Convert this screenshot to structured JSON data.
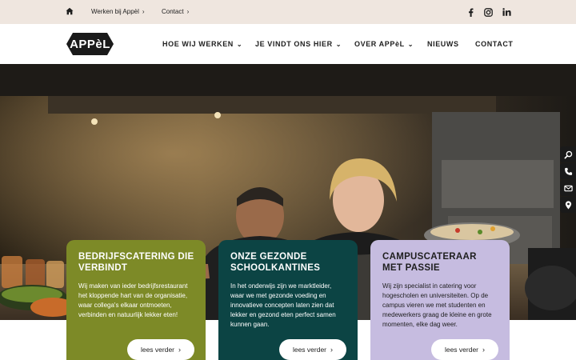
{
  "topbar": {
    "home_icon": "home-icon",
    "links": [
      {
        "label": "Werken bij Appèl"
      },
      {
        "label": "Contact"
      }
    ],
    "social_icons": [
      "facebook-icon",
      "instagram-icon",
      "linkedin-icon"
    ]
  },
  "nav": {
    "logo_text": "APPèL",
    "items": [
      {
        "label": "HOE WIJ WERKEN",
        "has_dropdown": true
      },
      {
        "label": "JE VINDT ONS HIER",
        "has_dropdown": true
      },
      {
        "label": "OVER APPèL",
        "has_dropdown": true
      },
      {
        "label": "NIEUWS",
        "has_dropdown": false
      },
      {
        "label": "CONTACT",
        "has_dropdown": false
      }
    ]
  },
  "side_toolbar": [
    "search-icon",
    "phone-icon",
    "mail-icon",
    "location-icon"
  ],
  "cards": [
    {
      "title": "BEDRIJFSCATERING DIE VERBINDT",
      "text": "Wij maken van ieder bedrijfsrestaurant het kloppende hart van de organisatie, waar collega's elkaar ontmoeten, verbinden en natuurlijk lekker eten!",
      "button": "lees verder",
      "color": "#7d8a27"
    },
    {
      "title": "ONZE GEZONDE SCHOOLKANTINES",
      "text": "In het onderwijs zijn we marktleider, waar we met gezonde voeding en innovatieve concepten laten zien dat lekker en gezond eten perfect samen kunnen gaan.",
      "button": "lees verder",
      "color": "#0c4444"
    },
    {
      "title": "CAMPUSCATERAAR MET PASSIE",
      "text": "Wij zijn specialist in catering voor hogescholen en universiteiten. Op de campus vieren we met studenten en medewerkers graag de kleine en grote momenten, elke dag weer.",
      "button": "lees verder",
      "color": "#c6bce0"
    }
  ],
  "colors": {
    "topbar_bg": "#efe6df",
    "logo_bg": "#1a1a1a",
    "card_green": "#7d8a27",
    "card_teal": "#0c4444",
    "card_lavender": "#c6bce0"
  }
}
